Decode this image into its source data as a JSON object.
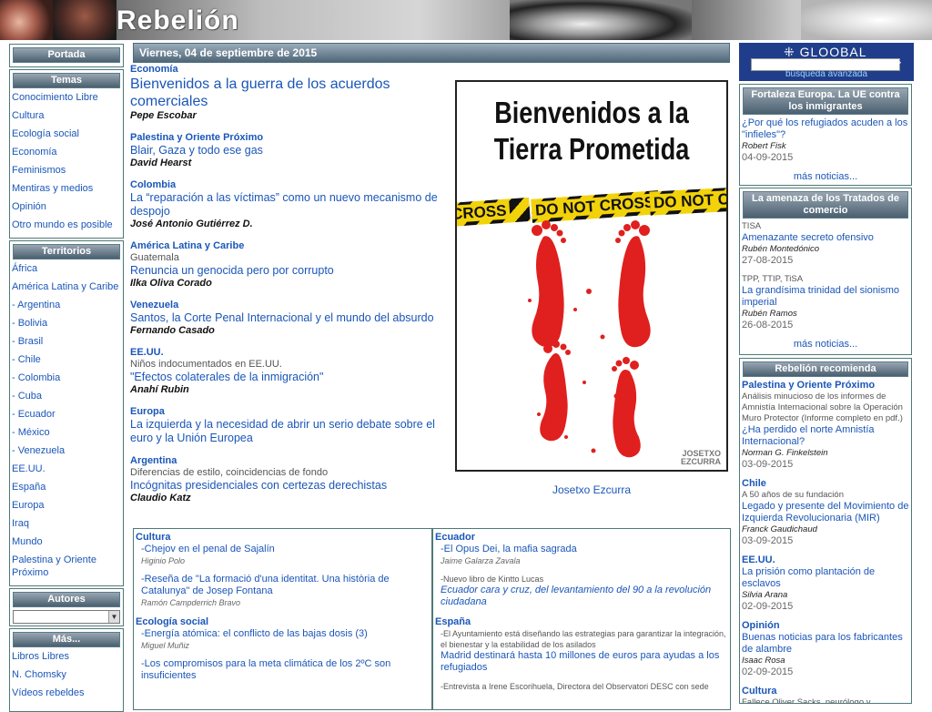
{
  "header": {
    "site_title": "Rebelión"
  },
  "left": {
    "portada": "Portada",
    "temas": {
      "title": "Temas",
      "items": [
        "Conocimiento Libre",
        "Cultura",
        "Ecología social",
        "Economía",
        "Feminismos",
        "Mentiras y medios",
        "Opinión",
        "Otro mundo es posible"
      ]
    },
    "territorios": {
      "title": "Territorios",
      "items": [
        "África",
        "América Latina y Caribe",
        " - Argentina",
        " - Bolivia",
        " - Brasil",
        " - Chile",
        " - Colombia",
        " - Cuba",
        " - Ecuador",
        " - México",
        " - Venezuela",
        "EE.UU.",
        "España",
        "Europa",
        "Iraq",
        "Mundo",
        "Palestina y Oriente Próximo"
      ]
    },
    "autores": {
      "title": "Autores",
      "select_value": ""
    },
    "mas": {
      "title": "Más...",
      "items": [
        "Libros Libres",
        "N. Chomsky",
        "Vídeos rebeldes"
      ]
    }
  },
  "main": {
    "date": "Viernes, 04 de septiembre de 2015",
    "articles": [
      {
        "cat": "Economía",
        "sub": "",
        "title": "Bienvenidos a la guerra de los acuerdos comerciales",
        "author": "Pepe Escobar",
        "big": true
      },
      {
        "cat": "Palestina y Oriente Próximo",
        "sub": "",
        "title": "Blair, Gaza y todo ese gas",
        "author": "David Hearst"
      },
      {
        "cat": "Colombia",
        "sub": "",
        "title": "La “reparación a las víctimas” como un nuevo mecanismo de despojo",
        "author": "José Antonio Gutiérrez D."
      },
      {
        "cat": "América Latina y Caribe",
        "sub": "Guatemala",
        "title": "Renuncia un genocida pero por corrupto",
        "author": "Ilka Oliva Corado"
      },
      {
        "cat": "Venezuela",
        "sub": "",
        "title": "Santos, la Corte Penal Internacional y el mundo del absurdo",
        "author": "Fernando Casado"
      },
      {
        "cat": "EE.UU.",
        "sub": "Niños indocumentados en EE.UU.",
        "title": "\"Efectos colaterales de la inmigración\"",
        "author": "Anahí Rubin"
      },
      {
        "cat": "Europa",
        "sub": "",
        "title": "La izquierda y la necesidad de abrir un serio debate sobre el euro y la Unión Europea",
        "author": ""
      },
      {
        "cat": "Argentina",
        "sub": "Diferencias de estilo, coincidencias de fondo",
        "title": "Incógnitas presidenciales con certezas derechistas",
        "author": "Claudio Katz"
      }
    ],
    "poster": {
      "title_line1": "Bienvenidos a la",
      "title_line2": "Tierra Prometida",
      "tape1": "CROSS",
      "tape2": "DO NOT CROSS",
      "tape3": "DO NOT CR",
      "signature1": "JOSETXO",
      "signature2": "EZCURRA",
      "caption": "Josetxo Ezcurra"
    },
    "lower_left": [
      {
        "section": "Cultura",
        "items": [
          {
            "sub": "",
            "title": "-Chejov en el penal de Sajalín",
            "author": "Higinio Polo"
          },
          {
            "sub": "",
            "title": "-Reseña de \"La formació d'una identitat. Una història de Catalunya\" de Josep Fontana",
            "author": "Ramón Campderrich Bravo"
          }
        ]
      },
      {
        "section": "Ecología social",
        "items": [
          {
            "sub": "",
            "title": "-Energía atómica: el conflicto de las bajas dosis (3)",
            "author": "Miguel Muñiz"
          },
          {
            "sub": "",
            "title": "-Los compromisos para la meta climática de los 2ºC son insuficientes",
            "author": ""
          }
        ]
      }
    ],
    "lower_right": [
      {
        "section": "Ecuador",
        "items": [
          {
            "sub": "",
            "title": "-El Opus Dei, la mafia sagrada",
            "author": "Jaime Galarza Zavala",
            "italic": false
          },
          {
            "sub": "-Nuevo libro de Kintto Lucas",
            "title": "Ecuador cara y cruz, del levantamiento del 90 a la revolución ciudadana",
            "author": "",
            "italic": true
          }
        ]
      },
      {
        "section": "España",
        "items": [
          {
            "sub": "-El Ayuntamiento está diseñando las estrategias para garantizar la integración, el bienestar y la estabilidad de los asilados",
            "title": "Madrid destinará hasta 10 millones de euros para ayudas a los refugiados",
            "author": "",
            "italic": false
          },
          {
            "sub": "-Entrevista a Irene Escorihuela, Directora del Observatori DESC con sede",
            "title": "",
            "author": "",
            "italic": false
          }
        ]
      }
    ]
  },
  "right": {
    "gloobal": {
      "logo": "GLOOBAL",
      "button": "->",
      "link": "búsqueda avanzada"
    },
    "box1": {
      "title": "Fortaleza Europa. La UE contra los inmigrantes",
      "items": [
        {
          "title": "¿Por qué los refugiados acuden a los \"infieles\"?",
          "author": "Robert Fisk",
          "date": "04-09-2015"
        }
      ],
      "more": "más noticias..."
    },
    "box2": {
      "title": "La amenaza de los Tratados de comercio",
      "items": [
        {
          "cat": "TISA",
          "title": "Amenazante secreto ofensivo",
          "author": "Rubén Montedónico",
          "date": "27-08-2015"
        },
        {
          "cat": "TPP, TTIP, TiSA",
          "title": "La grandísima trinidad del sionismo imperial",
          "author": "Rubén Ramos",
          "date": "26-08-2015"
        }
      ],
      "more": "más noticias..."
    },
    "box3": {
      "title": "Rebelión recomienda",
      "items": [
        {
          "catb": "Palestina y Oriente Próximo",
          "cat": "Análisis minucioso de los informes de Amnistía Internacional sobre la Operación Muro Protector (Informe completo en pdf.)",
          "title": "¿Ha perdido el norte Amnistía Internacional?",
          "author": "Norman G. Finkelstein",
          "date": "03-09-2015"
        },
        {
          "catb": "Chile",
          "cat": "A 50 años de su fundación",
          "title": "Legado y presente del Movimiento de Izquierda Revolucionaria (MIR)",
          "author": "Franck Gaudichaud",
          "date": "03-09-2015"
        },
        {
          "catb": "EE.UU.",
          "cat": "",
          "title": "La prisión como plantación de esclavos",
          "author": "Silvia Arana",
          "date": "02-09-2015"
        },
        {
          "catb": "Opinión",
          "cat": "",
          "title": "Buenas noticias para los fabricantes de alambre",
          "author": "Isaac Rosa",
          "date": "02-09-2015"
        },
        {
          "catb": "Cultura",
          "cat": "Fallece Oliver Sacks, neurólogo y divulgador",
          "title": "",
          "author": "",
          "date": ""
        }
      ]
    }
  },
  "colors": {
    "link": "#1a56b8",
    "box_border": "#4d7a77",
    "header_bar": "#4a6070",
    "gloobal_bg": "#1f3d8a",
    "footprint_red": "#e0201e",
    "tape_yellow": "#f2d20a"
  }
}
